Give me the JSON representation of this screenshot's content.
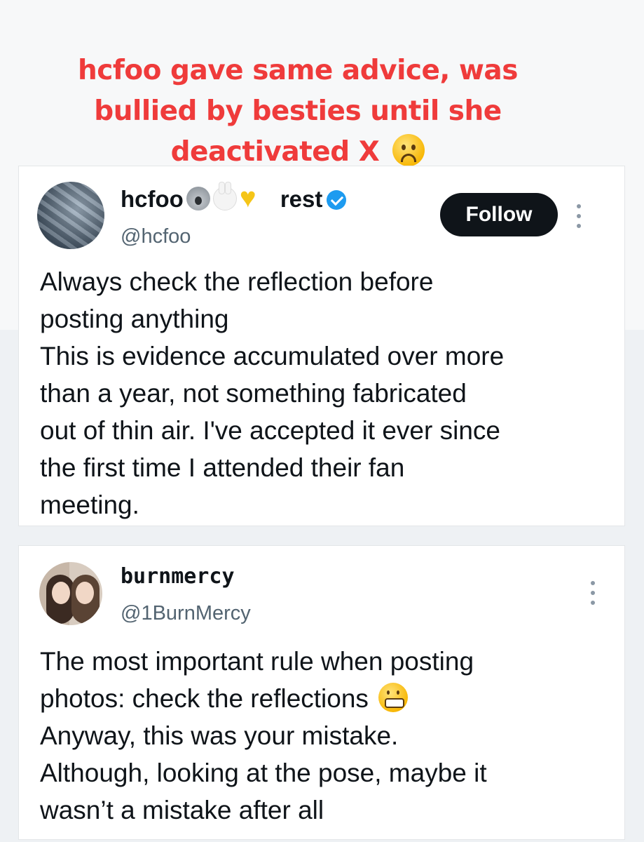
{
  "headline": {
    "lines": [
      "hcfoo gave same advice, was",
      "bullied by besties until she",
      "deactivated X"
    ],
    "emoji_icon": "frowning-face-icon",
    "color": "#ef3b3b"
  },
  "tweet1": {
    "display_name": "hcfoo",
    "name_emojis": [
      "koala-icon",
      "rabbit-face-icon",
      "yellow-heart-icon"
    ],
    "name_suffix": "rest",
    "verified": true,
    "handle": "@hcfoo",
    "follow_label": "Follow",
    "text_lines": [
      "Always check the reflection before",
      "posting anything",
      "This is evidence accumulated over more",
      "than a year, not something fabricated",
      "out of thin air. I've accepted it ever since",
      "the first time I attended their fan",
      "meeting."
    ]
  },
  "tweet2": {
    "display_name": "burnmercy",
    "handle": "@1BurnMercy",
    "text_lines": [
      "The most important rule when posting",
      "photos: check the reflections",
      "Anyway, this was your mistake.",
      "Although, looking at the pose, maybe it",
      "wasn’t a mistake after all"
    ],
    "inline_emoji": "grimacing-face-icon"
  },
  "colors": {
    "follow_bg": "#0f1419",
    "verified": "#1d9bf0",
    "handle": "#536471"
  }
}
